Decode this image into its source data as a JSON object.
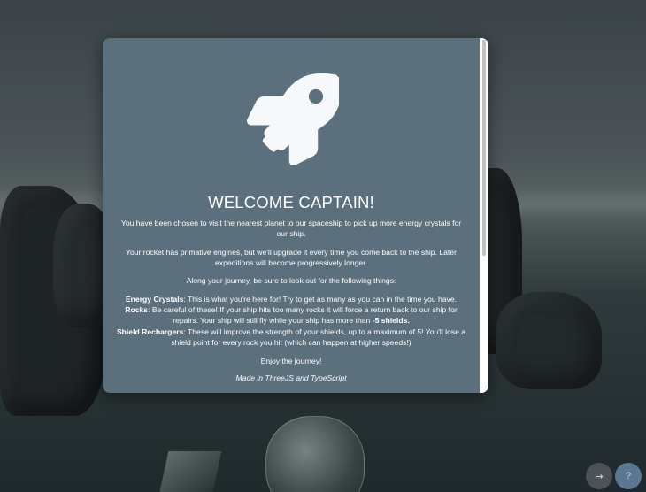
{
  "modal": {
    "title": "WELCOME CAPTAIN!",
    "intro": "You have been chosen to visit the nearest planet to our spaceship to pick up more energy crystals for our ship.",
    "engines": "Your rocket has primative engines, but we'll upgrade it every time you come back to the ship. Later expeditions will become progressively longer.",
    "lookout": "Along your journey, be sure to look out for the following things:",
    "items": [
      {
        "name": "Energy Crystals",
        "text": ": This is what you're here for! Try to get as many as you can in the time you have."
      },
      {
        "name": "Rocks",
        "text": ": Be careful of these! If your ship hits too many rocks it will force a return back to our ship for repairs. Your ship will still fly while your ship has more than ",
        "emphasis": "-5 shields."
      },
      {
        "name": "Shield Rechargers",
        "text": ": These will improve the strength of your shields, up to a maximum of 5! You'll lose a shield point for every rock you hit (which can happen at higher speeds!)"
      }
    ],
    "enjoy": "Enjoy the journey!",
    "credits": "Made in ThreeJS and TypeScript",
    "icon": "rocket-icon"
  },
  "controls": {
    "exit_icon": "exit-arrow-icon",
    "exit_glyph": "↦",
    "help_icon": "help-icon",
    "help_glyph": "?"
  },
  "colors": {
    "modal_bg": "#5b6f7c",
    "text": "#ffffff",
    "exit_button_bg": "#4c5257",
    "help_button_bg": "#5b7893"
  }
}
